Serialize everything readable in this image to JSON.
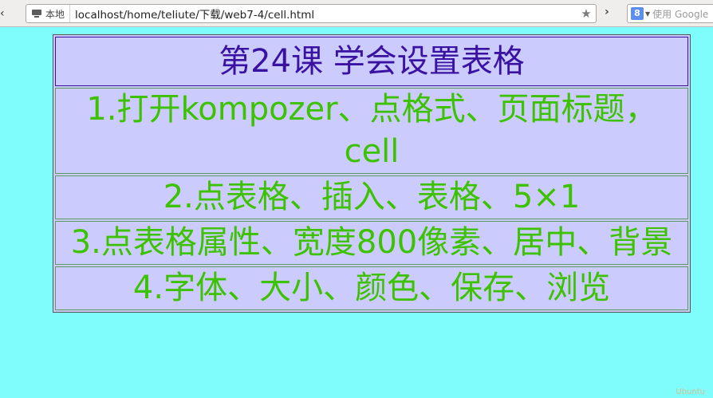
{
  "browser": {
    "site_label": "本地",
    "url": "localhost/home/teliute/下载/web7-4/cell.html",
    "search_placeholder": "使用 Google",
    "search_engine_letter": "8"
  },
  "icons": {
    "back": "chevron-left-icon",
    "site": "monitor-icon",
    "bookmark": "star-icon",
    "overflow": "chevron-right-icon",
    "search_engine": "google-icon",
    "search_dropdown": "caret-down-icon"
  },
  "colors": {
    "page_background": "#7ffcfc",
    "table_background": "#cccbfd",
    "title_text": "#3a12a2",
    "step_text": "#3cc200"
  },
  "lesson": {
    "title": "第24课  学会设置表格",
    "steps": [
      "1.打开kompozer、点格式、页面标题，cell",
      "2.点表格、插入、表格、5×1",
      "3.点表格属性、宽度800像素、居中、背景",
      "4.字体、大小、颜色、保存、浏览"
    ]
  },
  "watermark": "Ubuntu"
}
